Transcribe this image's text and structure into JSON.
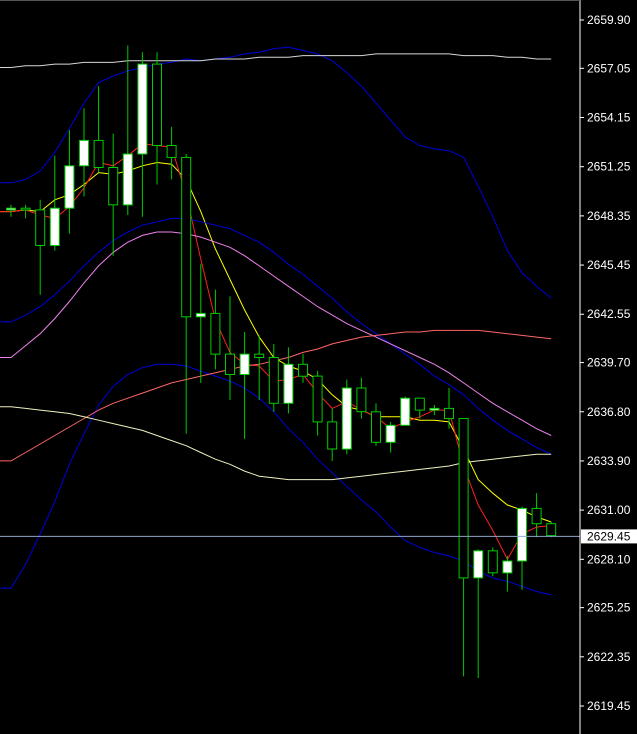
{
  "chart_data": {
    "type": "candlestick",
    "background_color": "#000000",
    "axis_color": "#ffffff",
    "grid": false,
    "y_axis_side": "right",
    "ylim": [
      2618.0,
      2661.5
    ],
    "y_ticks": [
      "2659.90",
      "2657.05",
      "2654.15",
      "2651.25",
      "2648.35",
      "2645.45",
      "2642.55",
      "2639.70",
      "2636.80",
      "2633.90",
      "2631.00",
      "2628.10",
      "2625.25",
      "2622.35",
      "2619.45"
    ],
    "current_price": {
      "value": 2629.45,
      "label": "2629.45",
      "line_color": "#8fa6c9",
      "tag_background": "#ffffff"
    },
    "candle_colors": {
      "bull_body": "#ffffff",
      "bear_body": "#000000",
      "outline": "#00cc00",
      "wick": "#00cc00"
    },
    "candles": [
      {
        "open": 2648.7,
        "high": 2649.0,
        "low": 2648.3,
        "close": 2648.8
      },
      {
        "open": 2648.8,
        "high": 2649.0,
        "low": 2648.2,
        "close": 2648.7
      },
      {
        "open": 2648.7,
        "high": 2649.3,
        "low": 2643.7,
        "close": 2646.6
      },
      {
        "open": 2646.6,
        "high": 2651.9,
        "low": 2646.3,
        "close": 2648.8
      },
      {
        "open": 2648.8,
        "high": 2653.4,
        "low": 2647.3,
        "close": 2651.3
      },
      {
        "open": 2651.3,
        "high": 2654.7,
        "low": 2649.5,
        "close": 2652.8
      },
      {
        "open": 2652.8,
        "high": 2656.0,
        "low": 2650.9,
        "close": 2651.2
      },
      {
        "open": 2651.2,
        "high": 2653.2,
        "low": 2646.0,
        "close": 2649.0
      },
      {
        "open": 2649.0,
        "high": 2658.4,
        "low": 2648.4,
        "close": 2652.0
      },
      {
        "open": 2652.0,
        "high": 2658.0,
        "low": 2648.3,
        "close": 2657.3
      },
      {
        "open": 2657.3,
        "high": 2658.0,
        "low": 2650.2,
        "close": 2652.5
      },
      {
        "open": 2652.5,
        "high": 2653.6,
        "low": 2650.5,
        "close": 2651.8
      },
      {
        "open": 2651.8,
        "high": 2652.0,
        "low": 2635.5,
        "close": 2642.4
      },
      {
        "open": 2642.4,
        "high": 2645.5,
        "low": 2638.5,
        "close": 2642.6
      },
      {
        "open": 2642.6,
        "high": 2644.0,
        "low": 2639.3,
        "close": 2640.2
      },
      {
        "open": 2640.2,
        "high": 2643.6,
        "low": 2637.5,
        "close": 2639.0
      },
      {
        "open": 2639.0,
        "high": 2641.5,
        "low": 2635.2,
        "close": 2640.2
      },
      {
        "open": 2640.2,
        "high": 2641.3,
        "low": 2637.5,
        "close": 2640.0
      },
      {
        "open": 2640.0,
        "high": 2640.8,
        "low": 2636.8,
        "close": 2637.3
      },
      {
        "open": 2637.3,
        "high": 2640.6,
        "low": 2636.7,
        "close": 2639.6
      },
      {
        "open": 2639.6,
        "high": 2640.2,
        "low": 2638.5,
        "close": 2638.9
      },
      {
        "open": 2638.9,
        "high": 2639.2,
        "low": 2635.4,
        "close": 2636.2
      },
      {
        "open": 2636.2,
        "high": 2637.0,
        "low": 2633.9,
        "close": 2634.6
      },
      {
        "open": 2634.6,
        "high": 2638.7,
        "low": 2634.3,
        "close": 2638.2
      },
      {
        "open": 2638.2,
        "high": 2638.8,
        "low": 2636.4,
        "close": 2636.8
      },
      {
        "open": 2636.8,
        "high": 2637.3,
        "low": 2634.8,
        "close": 2635.0
      },
      {
        "open": 2635.0,
        "high": 2636.2,
        "low": 2634.4,
        "close": 2636.0
      },
      {
        "open": 2636.0,
        "high": 2637.7,
        "low": 2636.2,
        "close": 2637.6
      },
      {
        "open": 2637.6,
        "high": 2637.6,
        "low": 2636.4,
        "close": 2636.9
      },
      {
        "open": 2636.9,
        "high": 2637.2,
        "low": 2636.6,
        "close": 2637.0
      },
      {
        "open": 2637.0,
        "high": 2638.2,
        "low": 2635.8,
        "close": 2636.4
      },
      {
        "open": 2636.4,
        "high": 2636.4,
        "low": 2621.2,
        "close": 2627.0
      },
      {
        "open": 2627.0,
        "high": 2628.7,
        "low": 2621.1,
        "close": 2628.6
      },
      {
        "open": 2628.6,
        "high": 2628.8,
        "low": 2627.1,
        "close": 2627.3
      },
      {
        "open": 2627.3,
        "high": 2628.3,
        "low": 2626.2,
        "close": 2628.0
      },
      {
        "open": 2628.0,
        "high": 2631.2,
        "low": 2626.3,
        "close": 2631.1
      },
      {
        "open": 2631.1,
        "high": 2632.0,
        "low": 2629.4,
        "close": 2630.2
      },
      {
        "open": 2630.2,
        "high": 2630.3,
        "low": 2629.4,
        "close": 2629.5
      }
    ],
    "series": [
      {
        "style": "line",
        "color": "#ffff00",
        "values": [
          2648.6,
          2648.7,
          2648.6,
          2649.3,
          2649.6,
          2650.2,
          2650.9,
          2650.8,
          2651.0,
          2651.3,
          2651.5,
          2651.4,
          2650.5,
          2648.6,
          2646.4,
          2644.6,
          2642.8,
          2641.2,
          2640.0,
          2639.5,
          2639.2,
          2638.7,
          2637.8,
          2637.1,
          2636.9,
          2636.5,
          2636.5,
          2636.5,
          2636.3,
          2636.3,
          2636.2,
          2634.6,
          2632.8,
          2632.0,
          2631.3,
          2631.0,
          2630.6,
          2630.3
        ]
      },
      {
        "style": "line",
        "color": "#ff2020",
        "values": [
          2648.6,
          2648.7,
          2648.4,
          2648.2,
          2648.9,
          2650.0,
          2651.5,
          2651.3,
          2651.9,
          2652.6,
          2652.5,
          2652.4,
          2649.6,
          2645.8,
          2642.2,
          2640.3,
          2639.6,
          2639.5,
          2638.6,
          2638.7,
          2639.0,
          2637.9,
          2637.0,
          2637.4,
          2636.9,
          2636.5,
          2635.8,
          2636.2,
          2636.5,
          2636.9,
          2636.9,
          2633.6,
          2631.3,
          2629.8,
          2628.1,
          2629.6,
          2630.0,
          2630.1
        ]
      },
      {
        "style": "line",
        "color": "#0000dd",
        "values": [
          2650.3,
          2650.5,
          2651.0,
          2652.1,
          2653.5,
          2655.0,
          2656.2,
          2656.6,
          2656.9,
          2657.1,
          2657.3,
          2657.4,
          2657.6,
          2657.5,
          2657.6,
          2657.7,
          2657.9,
          2658.0,
          2658.2,
          2658.3,
          2658.1,
          2657.9,
          2657.5,
          2656.8,
          2656.0,
          2655.0,
          2654.0,
          2653.0,
          2652.5,
          2652.3,
          2652.2,
          2651.8,
          2650.1,
          2648.3,
          2646.3,
          2645.0,
          2644.2,
          2643.5
        ]
      },
      {
        "style": "line",
        "color": "#0000dd",
        "values": [
          2642.1,
          2642.5,
          2643.0,
          2643.7,
          2644.5,
          2645.4,
          2646.2,
          2646.9,
          2647.4,
          2647.8,
          2648.0,
          2648.2,
          2648.2,
          2648.0,
          2647.8,
          2647.6,
          2647.2,
          2646.8,
          2646.2,
          2645.5,
          2644.9,
          2644.2,
          2643.5,
          2642.7,
          2642.0,
          2641.4,
          2640.8,
          2640.2,
          2639.6,
          2638.9,
          2638.4,
          2637.8,
          2637.0,
          2636.3,
          2635.7,
          2635.2,
          2634.7,
          2634.3
        ]
      },
      {
        "style": "line",
        "color": "#0000dd",
        "values": [
          2626.4,
          2627.8,
          2629.6,
          2631.5,
          2633.7,
          2635.5,
          2637.2,
          2638.3,
          2639.0,
          2639.4,
          2639.6,
          2639.6,
          2639.5,
          2639.2,
          2638.9,
          2638.6,
          2638.2,
          2637.6,
          2636.8,
          2635.8,
          2635.0,
          2634.0,
          2633.2,
          2632.4,
          2631.6,
          2630.9,
          2630.0,
          2629.2,
          2628.8,
          2628.5,
          2628.3,
          2628.0,
          2627.4,
          2627.0,
          2626.8,
          2626.5,
          2626.2,
          2626.0
        ]
      },
      {
        "style": "line",
        "color": "#ee82ee",
        "values": [
          2640.0,
          2640.7,
          2641.4,
          2642.3,
          2643.3,
          2644.4,
          2645.4,
          2646.2,
          2646.8,
          2647.2,
          2647.4,
          2647.4,
          2647.3,
          2647.1,
          2646.8,
          2646.5,
          2646.0,
          2645.4,
          2644.8,
          2644.2,
          2643.6,
          2643.0,
          2642.5,
          2642.0,
          2641.6,
          2641.2,
          2640.8,
          2640.4,
          2640.0,
          2639.6,
          2639.1,
          2638.5,
          2637.9,
          2637.3,
          2636.8,
          2636.3,
          2635.8,
          2635.4
        ]
      },
      {
        "style": "line",
        "color": "#ff6666",
        "values": [
          2633.9,
          2634.4,
          2634.9,
          2635.4,
          2635.9,
          2636.4,
          2636.9,
          2637.3,
          2637.6,
          2637.9,
          2638.2,
          2638.5,
          2638.7,
          2638.9,
          2639.1,
          2639.3,
          2639.5,
          2639.6,
          2639.8,
          2640.0,
          2640.3,
          2640.5,
          2640.8,
          2641.0,
          2641.2,
          2641.3,
          2641.4,
          2641.5,
          2641.5,
          2641.6,
          2641.6,
          2641.6,
          2641.6,
          2641.5,
          2641.4,
          2641.3,
          2641.2,
          2641.1
        ]
      },
      {
        "style": "line",
        "color": "#d8d8d8",
        "values": [
          2657.1,
          2657.2,
          2657.2,
          2657.3,
          2657.3,
          2657.4,
          2657.4,
          2657.4,
          2657.5,
          2657.5,
          2657.5,
          2657.5,
          2657.5,
          2657.5,
          2657.6,
          2657.6,
          2657.6,
          2657.7,
          2657.7,
          2657.7,
          2657.8,
          2657.8,
          2657.8,
          2657.8,
          2657.8,
          2657.9,
          2657.9,
          2657.9,
          2657.9,
          2657.9,
          2657.9,
          2657.8,
          2657.8,
          2657.8,
          2657.7,
          2657.7,
          2657.6,
          2657.6
        ]
      },
      {
        "style": "line",
        "color": "#f0f0c0",
        "values": [
          2637.1,
          2637.0,
          2636.9,
          2636.8,
          2636.7,
          2636.5,
          2636.3,
          2636.1,
          2635.9,
          2635.7,
          2635.4,
          2635.1,
          2634.8,
          2634.4,
          2634.0,
          2633.7,
          2633.3,
          2633.0,
          2632.9,
          2632.8,
          2632.8,
          2632.8,
          2632.8,
          2632.9,
          2633.0,
          2633.1,
          2633.2,
          2633.3,
          2633.4,
          2633.5,
          2633.6,
          2633.8,
          2633.9,
          2634.0,
          2634.1,
          2634.2,
          2634.3,
          2634.3
        ]
      }
    ]
  }
}
